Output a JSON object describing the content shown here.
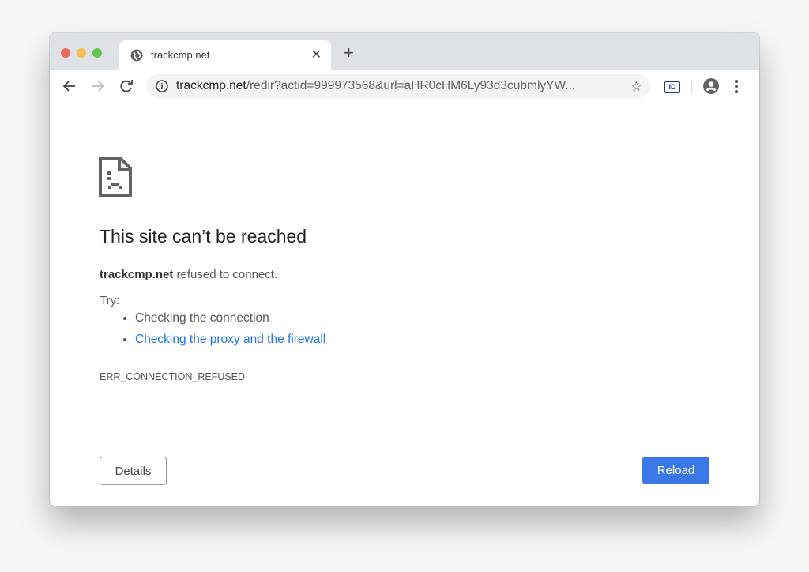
{
  "browser": {
    "tab": {
      "title": "trackcmp.net",
      "icon": "globe-icon"
    },
    "new_tab_label": "+",
    "close_tab_label": "✕",
    "address": {
      "domain": "trackcmp.net",
      "path": "/redir?actid=999973568&url=aHR0cHM6Ly93d3cubmlyYW..."
    },
    "extension_label": "iD"
  },
  "page": {
    "heading": "This site can’t be reached",
    "host": "trackcmp.net",
    "message": " refused to connect.",
    "try_label": "Try:",
    "suggestions": [
      {
        "text": "Checking the connection",
        "link": false
      },
      {
        "text": "Checking the proxy and the firewall",
        "link": true
      }
    ],
    "error_code": "ERR_CONNECTION_REFUSED",
    "details_button": "Details",
    "reload_button": "Reload"
  },
  "colors": {
    "link": "#1a73e8",
    "primary_button": "#3b78e7"
  }
}
